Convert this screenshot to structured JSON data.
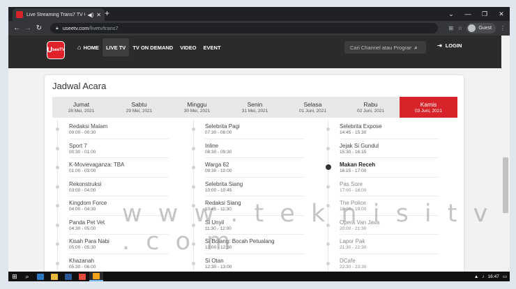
{
  "browser": {
    "tab_title": "Live Streaming Trans7 TV Onl",
    "new_tab": "+",
    "url_host": "useetv.com",
    "url_path": "/livetv/trans7",
    "profile": "Guest",
    "win": {
      "min": "—",
      "max": "❐",
      "close": "✕"
    }
  },
  "site": {
    "logo": "U",
    "logo_sub": "seeTV",
    "menu": [
      "HOME",
      "LIVE TV",
      "TV ON DEMAND",
      "VIDEO",
      "EVENT"
    ],
    "search_placeholder": "Cari Channel atau Program",
    "login": "LOGIN"
  },
  "schedule": {
    "title": "Jadwal Acara",
    "days": [
      {
        "name": "Jumat",
        "date": "28 Mei, 2021"
      },
      {
        "name": "Sabtu",
        "date": "29 Mei, 2021"
      },
      {
        "name": "Minggu",
        "date": "30 Mei, 2021"
      },
      {
        "name": "Senin",
        "date": "31 Mei, 2021"
      },
      {
        "name": "Selasa",
        "date": "01 Juni, 2021"
      },
      {
        "name": "Rabu",
        "date": "02 Juni, 2021"
      },
      {
        "name": "Kamis",
        "date": "03 Juni, 2021"
      }
    ],
    "active_day": 6,
    "columns": [
      [
        {
          "title": "Redaksi Malam",
          "time": "00:00 - 00:30"
        },
        {
          "title": "Sport 7",
          "time": "00:30 - 01:00"
        },
        {
          "title": "K-Movievaganza: TBA",
          "time": "01:00 - 03:00"
        },
        {
          "title": "Rekonstruksi",
          "time": "03:00 - 04:00"
        },
        {
          "title": "Kingdom Force",
          "time": "04:00 - 04:30"
        },
        {
          "title": "Panda Pet Vet",
          "time": "04:30 - 05:00"
        },
        {
          "title": "Kisah Para Nabi",
          "time": "05:00 - 05:30"
        },
        {
          "title": "Khazanah",
          "time": "05:30 - 06:00"
        }
      ],
      [
        {
          "title": "Selebrita Pagi",
          "time": "07:30 - 08:00"
        },
        {
          "title": "Inline",
          "time": "08:30 - 09:30"
        },
        {
          "title": "Warga 62",
          "time": "09:30 - 10:00"
        },
        {
          "title": "Selebrita Siang",
          "time": "10:00 - 10:45"
        },
        {
          "title": "Redaksi Siang",
          "time": "10:45 - 11:30"
        },
        {
          "title": "Si Unyil",
          "time": "11:30 - 12:00"
        },
        {
          "title": "Si Bolang: Bocah Petualang",
          "time": "12:00 - 12:30"
        },
        {
          "title": "Si Otan",
          "time": "12:30 - 13:00"
        }
      ],
      [
        {
          "title": "Selebrita Expose",
          "time": "14:45 - 15:30"
        },
        {
          "title": "Jejak Si Gundul",
          "time": "15:30 - 16:15"
        },
        {
          "title": "Makan Receh",
          "time": "16:15 - 17:00"
        },
        {
          "title": "Pas Sore",
          "time": "17:00 - 18:00"
        },
        {
          "title": "The Police",
          "time": "18:00 - 19:00"
        },
        {
          "title": "Opera Van Java",
          "time": "20:00 - 21:30"
        },
        {
          "title": "Lapor Pak",
          "time": "21:30 - 22:30"
        },
        {
          "title": "DCafe",
          "time": "22:30 - 23:30"
        }
      ]
    ],
    "current": {
      "column": 2,
      "index": 2
    }
  },
  "watermark": "w w w . t e k n i s i t v . c o m",
  "taskbar": {
    "clock": "16:47",
    "apps": [
      "#2b79c2",
      "#e8b93e",
      "#2b5797",
      "#e04b3a",
      "#f7a21b"
    ]
  },
  "colors": {
    "accent": "#d7242a",
    "nav_bg": "#2b2b2b"
  }
}
